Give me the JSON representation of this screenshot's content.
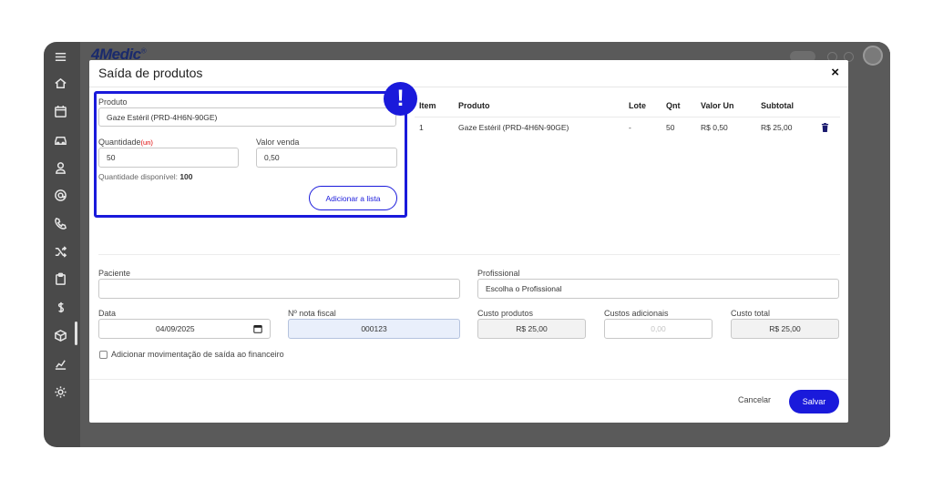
{
  "app": {
    "logo_text": "4Medic",
    "logo_mark": "®"
  },
  "sidebar": {
    "items": [
      {
        "icon": "menu-icon"
      },
      {
        "icon": "home-icon"
      },
      {
        "icon": "calendar-icon"
      },
      {
        "icon": "car-icon"
      },
      {
        "icon": "user-icon"
      },
      {
        "icon": "at-icon"
      },
      {
        "icon": "phone-icon"
      },
      {
        "icon": "shuffle-icon"
      },
      {
        "icon": "clipboard-icon"
      },
      {
        "icon": "dollar-icon"
      },
      {
        "icon": "box-icon"
      },
      {
        "icon": "chart-icon"
      },
      {
        "icon": "gear-icon"
      }
    ]
  },
  "modal": {
    "title": "Saída de produtos",
    "close_label": "×",
    "alert_label": "!",
    "produto_label": "Produto",
    "produto_value": "Gaze Estéril (PRD-4H6N-90GE)",
    "quantidade_label": "Quantidade",
    "quantidade_unit": "(un)",
    "quantidade_value": "50",
    "valor_venda_label": "Valor venda",
    "valor_venda_value": "0,50",
    "disponivel_label": "Quantidade disponível: ",
    "disponivel_value": "100",
    "add_button": "Adicionar a lista",
    "table": {
      "headers": [
        "Item",
        "Produto",
        "Lote",
        "Qnt",
        "Valor Un",
        "Subtotal"
      ],
      "rows": [
        {
          "item": "1",
          "produto": "Gaze Estéril (PRD-4H6N-90GE)",
          "lote": "-",
          "qnt": "50",
          "valor_un": "R$ 0,50",
          "subtotal": "R$ 25,00"
        }
      ]
    },
    "paciente_label": "Paciente",
    "paciente_value": "",
    "profissional_label": "Profissional",
    "profissional_placeholder": "Escolha o Profissional",
    "data_label": "Data",
    "data_value": "04/09/2025",
    "nota_label": "Nº nota fiscal",
    "nota_value": "000123",
    "custo_produtos_label": "Custo produtos",
    "custo_produtos_value": "R$ 25,00",
    "custos_adicionais_label": "Custos adicionais",
    "custos_adicionais_placeholder": "0,00",
    "custo_total_label": "Custo total",
    "custo_total_value": "R$ 25,00",
    "checkbox_label": "Adicionar movimentação de saída ao financeiro",
    "cancel_label": "Cancelar",
    "save_label": "Salvar"
  },
  "colors": {
    "accent": "#1a1adb",
    "frame": "#4a4a4a"
  }
}
